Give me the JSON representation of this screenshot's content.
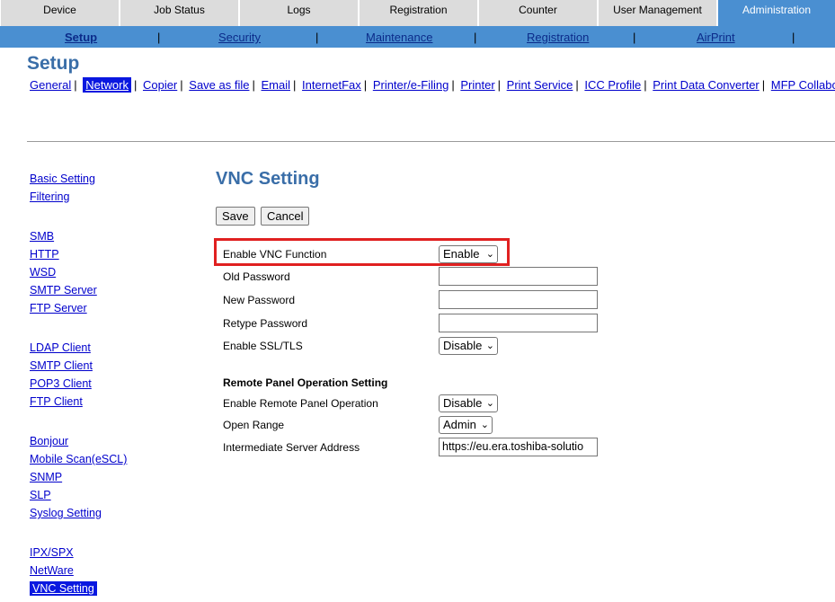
{
  "tabs": [
    {
      "label": "Device"
    },
    {
      "label": "Job Status"
    },
    {
      "label": "Logs"
    },
    {
      "label": "Registration"
    },
    {
      "label": "Counter"
    },
    {
      "label": "User Management"
    },
    {
      "label": "Administration"
    }
  ],
  "subnav": [
    {
      "label": "Setup"
    },
    {
      "label": "Security"
    },
    {
      "label": "Maintenance"
    },
    {
      "label": "Registration"
    },
    {
      "label": "AirPrint"
    }
  ],
  "subnav_separator": "|",
  "page_title": "Setup",
  "categories": [
    {
      "label": "General"
    },
    {
      "label": "Network"
    },
    {
      "label": "Copier"
    },
    {
      "label": "Save as file"
    },
    {
      "label": "Email"
    },
    {
      "label": "InternetFax"
    },
    {
      "label": "Printer/e-Filing"
    },
    {
      "label": "Printer"
    },
    {
      "label": "Print Service"
    },
    {
      "label": "ICC Profile"
    },
    {
      "label": "Print Data Converter"
    },
    {
      "label": "MFP Collaborat"
    }
  ],
  "leftmenu": [
    {
      "label": "Basic Setting"
    },
    {
      "label": "Filtering"
    },
    {
      "label": "SMB"
    },
    {
      "label": "HTTP"
    },
    {
      "label": "WSD"
    },
    {
      "label": "SMTP Server"
    },
    {
      "label": "FTP Server"
    },
    {
      "label": "LDAP Client"
    },
    {
      "label": "SMTP Client"
    },
    {
      "label": "POP3 Client"
    },
    {
      "label": "FTP Client"
    },
    {
      "label": "Bonjour"
    },
    {
      "label": "Mobile Scan(eSCL)"
    },
    {
      "label": "SNMP"
    },
    {
      "label": "SLP"
    },
    {
      "label": "Syslog Setting"
    },
    {
      "label": "IPX/SPX"
    },
    {
      "label": "NetWare"
    },
    {
      "label": "VNC Setting"
    }
  ],
  "main": {
    "title": "VNC Setting",
    "save_label": "Save",
    "cancel_label": "Cancel",
    "enable_vnc_label": "Enable VNC Function",
    "enable_vnc_value": "Enable",
    "old_password_label": "Old Password",
    "old_password_value": "",
    "new_password_label": "New Password",
    "new_password_value": "",
    "retype_password_label": "Retype Password",
    "retype_password_value": "",
    "ssl_label": "Enable SSL/TLS",
    "ssl_value": "Disable",
    "remote_section": "Remote Panel Operation Setting",
    "remote_enable_label": "Enable Remote Panel Operation",
    "remote_enable_value": "Disable",
    "open_range_label": "Open Range",
    "open_range_value": "Admin",
    "server_address_label": "Intermediate Server Address",
    "server_address_value": "https://eu.era.toshiba-solutio"
  },
  "colors": {
    "active_tab": "#4a8fd1",
    "highlight_border": "#e02020",
    "selected_link_bg": "#0a18e0"
  }
}
